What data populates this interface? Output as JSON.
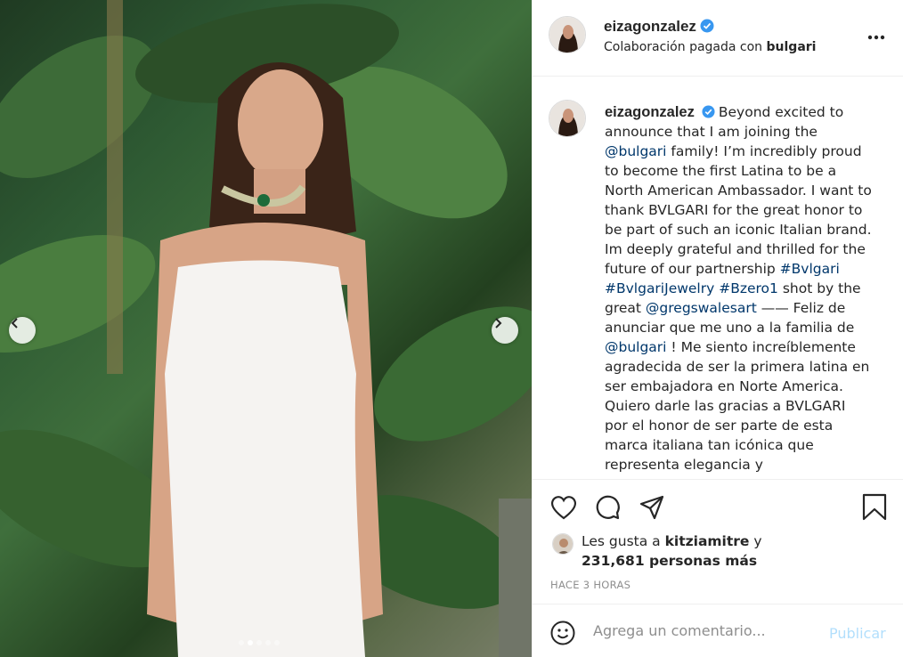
{
  "post": {
    "username": "eizagonzalez",
    "verified": true,
    "paid_partnership_prefix": "Colaboración pagada con",
    "partner": "bulgari",
    "more_icon": "more-horizontal-icon"
  },
  "caption": {
    "username": "eizagonzalez",
    "segments": [
      {
        "type": "text",
        "value": "Beyond excited to announce that I am joining the "
      },
      {
        "type": "link",
        "value": "@bulgari"
      },
      {
        "type": "text",
        "value": " family! I’m incredibly proud to become the first Latina to be a North American Ambassador. I want to thank BVLGARI for the great honor to be part of such an iconic Italian brand. Im deeply grateful and thrilled for the future of our partnership "
      },
      {
        "type": "link",
        "value": "#Bvlgari"
      },
      {
        "type": "text",
        "value": " "
      },
      {
        "type": "link",
        "value": "#BvlgariJewelry"
      },
      {
        "type": "text",
        "value": " "
      },
      {
        "type": "link",
        "value": "#Bzero1"
      },
      {
        "type": "text",
        "value": " shot by the great "
      },
      {
        "type": "link",
        "value": "@gregswalesart"
      },
      {
        "type": "text",
        "value": " —— Feliz de anunciar que me uno a la familia de "
      },
      {
        "type": "link",
        "value": "@bulgari"
      },
      {
        "type": "text",
        "value": " ! Me siento increíblemente agradecida de ser la primera latina en ser embajadora en Norte America. Quiero darle las gracias a BVLGARI por el honor de ser parte de esta marca italiana tan icónica que representa elegancia y"
      }
    ]
  },
  "carousel": {
    "dot_count": 5,
    "active_index": 1,
    "prev_icon": "chevron-left-icon",
    "next_icon": "chevron-right-icon"
  },
  "actions": {
    "like_icon": "heart-icon",
    "comment_icon": "comment-icon",
    "share_icon": "send-icon",
    "save_icon": "bookmark-icon"
  },
  "likes": {
    "prefix": "Les gusta a",
    "user": "kitziamitre",
    "connector": "y",
    "count_text": "231,681 personas más"
  },
  "timestamp": "HACE 3 HORAS",
  "comment_box": {
    "emoji_icon": "emoji-icon",
    "placeholder": "Agrega un comentario...",
    "publish_label": "Publicar"
  },
  "colors": {
    "link": "#00376b",
    "verified": "#3897f0",
    "publish_disabled": "#b2dffc",
    "muted": "#8e8e8e"
  }
}
